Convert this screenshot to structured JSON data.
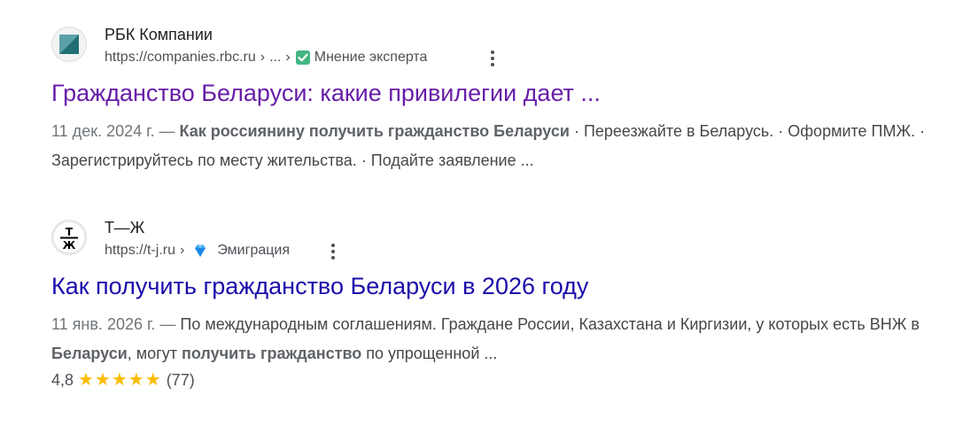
{
  "results": [
    {
      "site_name": "РБК Компании",
      "url": "https://companies.rbc.ru",
      "breadcrumb_sep1": "›",
      "breadcrumb_ellipsis": "...",
      "breadcrumb_sep2": "›",
      "badge_icon": "checkmark-green-icon",
      "badge_label": "Мнение эксперта",
      "title": "Гражданство Беларуси: какие привилегии дает ...",
      "title_state": "visited",
      "date": "11 дек. 2024 г. —",
      "snippet_bold_1": "Как россиянину получить гражданство Беларуси",
      "snippet_text_1": "· Переезжайте в Беларусь. · Оформите ПМЖ. · Зарегистрируйтесь по месту жительства. · Подайте заявление ..."
    },
    {
      "site_name": "Т—Ж",
      "favicon_text": "Т Ж",
      "url": "https://t-j.ru",
      "breadcrumb_sep1": "›",
      "badge_icon": "blue-diamond-icon",
      "badge_label": "Эмиграция",
      "title": "Как получить гражданство Беларуси в 2026 году",
      "title_state": "unvisited",
      "date": "11 янв. 2026 г. —",
      "snippet_text_1": "По международным соглашениям. Граждане России, Казахстана и Киргизии, у которых есть ВНЖ в",
      "snippet_bold_1": "Беларуси",
      "snippet_text_2": ", могут",
      "snippet_bold_2": "получить гражданство",
      "snippet_text_3": "по упрощенной ...",
      "rating_value": "4,8",
      "rating_stars": "★★★★★",
      "rating_count": "(77)"
    }
  ],
  "colors": {
    "visited_link": "#681da8",
    "link": "#1a0dab",
    "star": "#fbbc04"
  }
}
